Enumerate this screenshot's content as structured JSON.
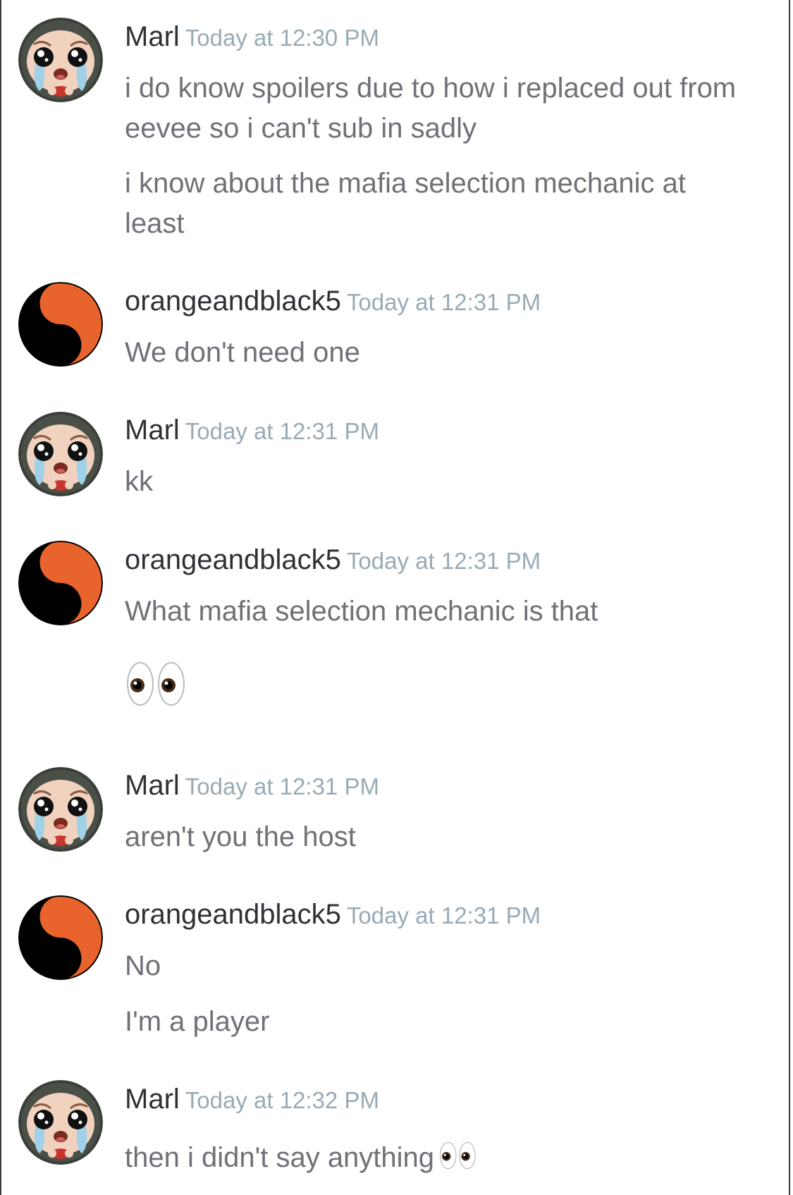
{
  "colors": {
    "username": "#2e3136",
    "timestamp": "#99aab5",
    "message": "#6e7177",
    "yinyang_orange": "#e8642c",
    "yinyang_black": "#000000"
  },
  "messages": [
    {
      "author": "Marl",
      "avatar": "crying-face-avatar",
      "time": "Today at 12:30 PM",
      "lines": [
        "i do know spoilers due to how i replaced out from eevee so i can't sub in sadly",
        "i know about the mafia selection mechanic at least"
      ]
    },
    {
      "author": "orangeandblack5",
      "avatar": "yin-yang-avatar",
      "time": "Today at 12:31 PM",
      "lines": [
        "We don't need one"
      ]
    },
    {
      "author": "Marl",
      "avatar": "crying-face-avatar",
      "time": "Today at 12:31 PM",
      "lines": [
        "kk"
      ]
    },
    {
      "author": "orangeandblack5",
      "avatar": "yin-yang-avatar",
      "time": "Today at 12:31 PM",
      "lines": [
        "What mafia selection mechanic is that"
      ],
      "emoji": "eyes-emoji"
    },
    {
      "author": "Marl",
      "avatar": "crying-face-avatar",
      "time": "Today at 12:31 PM",
      "lines": [
        "aren't you the host"
      ]
    },
    {
      "author": "orangeandblack5",
      "avatar": "yin-yang-avatar",
      "time": "Today at 12:31 PM",
      "lines": [
        "No",
        "I'm a player"
      ]
    },
    {
      "author": "Marl",
      "avatar": "crying-face-avatar",
      "time": "Today at 12:32 PM",
      "lines": [
        "then i didn't say anything"
      ],
      "inline_emoji": "eyes-emoji"
    }
  ]
}
